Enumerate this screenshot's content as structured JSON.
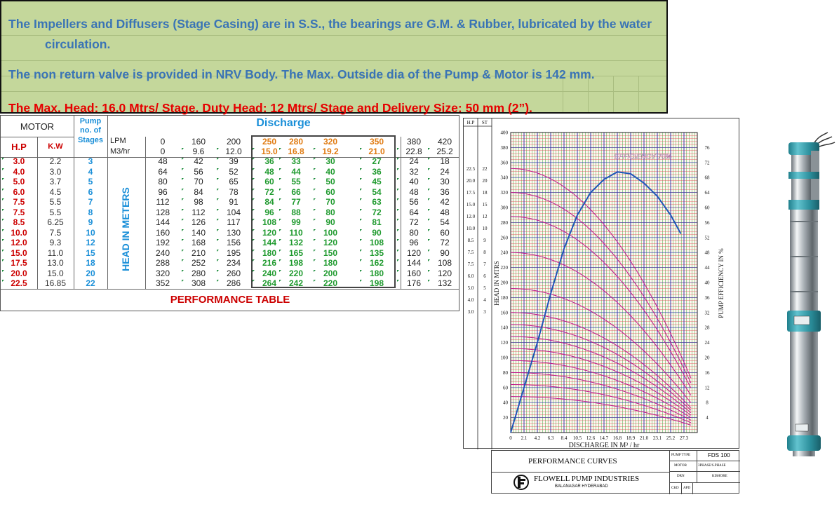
{
  "description": {
    "line1a": "The Impellers and Diffusers (Stage Casing) are in S.S., the bearings are G.M. & Rubber, lubricated by the water",
    "line1b": "circulation.",
    "line2": "The non return valve is provided in NRV Body.  The Max.  Outside dia of the Pump & Motor is 142 mm.",
    "line3": "The Max. Head: 16.0 Mtrs/ Stage. Duty Head: 12 Mtrs/ Stage and Delivery Size: 50 mm (2”)."
  },
  "table": {
    "motor_header": "MOTOR",
    "pump_header_1": "Pump",
    "pump_header_2": "no. of",
    "pump_header_3": "Stages",
    "hp_header": "H.P",
    "kw_header": "K.W",
    "discharge_header": "Discharge",
    "lpm_label": "LPM",
    "m3_label": "M3/hr",
    "head_label": "HEAD IN METERS",
    "footer": "PERFORMANCE TABLE",
    "lpm": [
      "0",
      "160",
      "200",
      "250",
      "280",
      "320",
      "350",
      "380",
      "420"
    ],
    "m3hr": [
      "0",
      "9.6",
      "12.0",
      "15.0",
      "16.8",
      "19.2",
      "21.0",
      "22.8",
      "25.2"
    ],
    "rows": [
      {
        "hp": "3.0",
        "kw": "2.2",
        "stages": "3",
        "heads": [
          "48",
          "42",
          "39",
          "36",
          "33",
          "30",
          "27",
          "24",
          "18"
        ]
      },
      {
        "hp": "4.0",
        "kw": "3.0",
        "stages": "4",
        "heads": [
          "64",
          "56",
          "52",
          "48",
          "44",
          "40",
          "36",
          "32",
          "24"
        ]
      },
      {
        "hp": "5.0",
        "kw": "3.7",
        "stages": "5",
        "heads": [
          "80",
          "70",
          "65",
          "60",
          "55",
          "50",
          "45",
          "40",
          "30"
        ]
      },
      {
        "hp": "6.0",
        "kw": "4.5",
        "stages": "6",
        "heads": [
          "96",
          "84",
          "78",
          "72",
          "66",
          "60",
          "54",
          "48",
          "36"
        ]
      },
      {
        "hp": "7.5",
        "kw": "5.5",
        "stages": "7",
        "heads": [
          "112",
          "98",
          "91",
          "84",
          "77",
          "70",
          "63",
          "56",
          "42"
        ]
      },
      {
        "hp": "7.5",
        "kw": "5.5",
        "stages": "8",
        "heads": [
          "128",
          "112",
          "104",
          "96",
          "88",
          "80",
          "72",
          "64",
          "48"
        ]
      },
      {
        "hp": "8.5",
        "kw": "6.25",
        "stages": "9",
        "heads": [
          "144",
          "126",
          "117",
          "108",
          "99",
          "90",
          "81",
          "72",
          "54"
        ]
      },
      {
        "hp": "10.0",
        "kw": "7.5",
        "stages": "10",
        "heads": [
          "160",
          "140",
          "130",
          "120",
          "110",
          "100",
          "90",
          "80",
          "60"
        ]
      },
      {
        "hp": "12.0",
        "kw": "9.3",
        "stages": "12",
        "heads": [
          "192",
          "168",
          "156",
          "144",
          "132",
          "120",
          "108",
          "96",
          "72"
        ]
      },
      {
        "hp": "15.0",
        "kw": "11.0",
        "stages": "15",
        "heads": [
          "240",
          "210",
          "195",
          "180",
          "165",
          "150",
          "135",
          "120",
          "90"
        ]
      },
      {
        "hp": "17.5",
        "kw": "13.0",
        "stages": "18",
        "heads": [
          "288",
          "252",
          "234",
          "216",
          "198",
          "180",
          "162",
          "144",
          "108"
        ]
      },
      {
        "hp": "20.0",
        "kw": "15.0",
        "stages": "20",
        "heads": [
          "320",
          "280",
          "260",
          "240",
          "220",
          "200",
          "180",
          "160",
          "120"
        ]
      },
      {
        "hp": "22.5",
        "kw": "16.85",
        "stages": "22",
        "heads": [
          "352",
          "308",
          "286",
          "264",
          "242",
          "220",
          "198",
          "176",
          "132"
        ]
      }
    ]
  },
  "chart_data": {
    "type": "line",
    "xlabel": "DISCHARGE IN M³ / hr",
    "ylabel": "HEAD  IN  MTRS",
    "y2label": "PUMP EFFICIENCY IN %",
    "annotation": "EFFICIENCY 70%",
    "x_ticks": [
      "0",
      "2.1",
      "4.2",
      "6.3",
      "8.4",
      "10.5",
      "12.6",
      "14.7",
      "16.8",
      "18.9",
      "21.0",
      "23.1",
      "25.2",
      "27.3"
    ],
    "y_ticks": [
      "400",
      "380",
      "360",
      "340",
      "320",
      "300",
      "280",
      "260",
      "240",
      "220",
      "200",
      "180",
      "160",
      "140",
      "120",
      "100",
      "80",
      "60",
      "40",
      "20"
    ],
    "y2_ticks": [
      "76",
      "72",
      "68",
      "64",
      "60",
      "56",
      "52",
      "48",
      "44",
      "40",
      "36",
      "32",
      "28",
      "24",
      "20",
      "16",
      "12",
      "8",
      "4"
    ],
    "xlim": [
      0,
      29.4
    ],
    "ylim": [
      0,
      400
    ],
    "y2lim": [
      0,
      80
    ],
    "hp_header": "H.P",
    "st_header": "ST",
    "hp_st": [
      {
        "hp": "22.5",
        "st": "22",
        "head": 352
      },
      {
        "hp": "20.0",
        "st": "20",
        "head": 320
      },
      {
        "hp": "17.5",
        "st": "18",
        "head": 288
      },
      {
        "hp": "15.0",
        "st": "15",
        "head": 240
      },
      {
        "hp": "12.0",
        "st": "12",
        "head": 192
      },
      {
        "hp": "10.0",
        "st": "10",
        "head": 160
      },
      {
        "hp": "8.5",
        "st": "9",
        "head": 144
      },
      {
        "hp": "7.5",
        "st": "8",
        "head": 128
      },
      {
        "hp": "7.5",
        "st": "7",
        "head": 112
      },
      {
        "hp": "6.0",
        "st": "6",
        "head": 96
      },
      {
        "hp": "5.0",
        "st": "5",
        "head": 80
      },
      {
        "hp": "4.0",
        "st": "4",
        "head": 64
      },
      {
        "hp": "3.0",
        "st": "3",
        "head": 48
      }
    ],
    "series": [
      {
        "x": [
          0,
          9.6,
          12.0,
          15.0,
          16.8,
          19.2,
          21.0,
          22.8,
          25.2
        ],
        "values": [
          352,
          308,
          286,
          264,
          242,
          220,
          198,
          176,
          132
        ]
      },
      {
        "x": [
          0,
          9.6,
          12.0,
          15.0,
          16.8,
          19.2,
          21.0,
          22.8,
          25.2
        ],
        "values": [
          320,
          280,
          260,
          240,
          220,
          200,
          180,
          160,
          120
        ]
      },
      {
        "x": [
          0,
          9.6,
          12.0,
          15.0,
          16.8,
          19.2,
          21.0,
          22.8,
          25.2
        ],
        "values": [
          288,
          252,
          234,
          216,
          198,
          180,
          162,
          144,
          108
        ]
      },
      {
        "x": [
          0,
          9.6,
          12.0,
          15.0,
          16.8,
          19.2,
          21.0,
          22.8,
          25.2
        ],
        "values": [
          240,
          210,
          195,
          180,
          165,
          150,
          135,
          120,
          90
        ]
      },
      {
        "x": [
          0,
          9.6,
          12.0,
          15.0,
          16.8,
          19.2,
          21.0,
          22.8,
          25.2
        ],
        "values": [
          192,
          168,
          156,
          144,
          132,
          120,
          108,
          96,
          72
        ]
      },
      {
        "x": [
          0,
          9.6,
          12.0,
          15.0,
          16.8,
          19.2,
          21.0,
          22.8,
          25.2
        ],
        "values": [
          160,
          140,
          130,
          120,
          110,
          100,
          90,
          80,
          60
        ]
      },
      {
        "x": [
          0,
          9.6,
          12.0,
          15.0,
          16.8,
          19.2,
          21.0,
          22.8,
          25.2
        ],
        "values": [
          144,
          126,
          117,
          108,
          99,
          90,
          81,
          72,
          54
        ]
      },
      {
        "x": [
          0,
          9.6,
          12.0,
          15.0,
          16.8,
          19.2,
          21.0,
          22.8,
          25.2
        ],
        "values": [
          128,
          112,
          104,
          96,
          88,
          80,
          72,
          64,
          48
        ]
      },
      {
        "x": [
          0,
          9.6,
          12.0,
          15.0,
          16.8,
          19.2,
          21.0,
          22.8,
          25.2
        ],
        "values": [
          112,
          98,
          91,
          84,
          77,
          70,
          63,
          56,
          42
        ]
      },
      {
        "x": [
          0,
          9.6,
          12.0,
          15.0,
          16.8,
          19.2,
          21.0,
          22.8,
          25.2
        ],
        "values": [
          96,
          84,
          78,
          72,
          66,
          60,
          54,
          48,
          36
        ]
      },
      {
        "x": [
          0,
          9.6,
          12.0,
          15.0,
          16.8,
          19.2,
          21.0,
          22.8,
          25.2
        ],
        "values": [
          80,
          70,
          65,
          60,
          55,
          50,
          45,
          40,
          30
        ]
      },
      {
        "x": [
          0,
          9.6,
          12.0,
          15.0,
          16.8,
          19.2,
          21.0,
          22.8,
          25.2
        ],
        "values": [
          64,
          56,
          52,
          48,
          44,
          40,
          36,
          32,
          24
        ]
      },
      {
        "x": [
          0,
          9.6,
          12.0,
          15.0,
          16.8,
          19.2,
          21.0,
          22.8,
          25.2
        ],
        "values": [
          48,
          42,
          39,
          36,
          33,
          30,
          27,
          24,
          18
        ]
      }
    ],
    "efficiency": {
      "x": [
        0,
        2.1,
        4.2,
        6.3,
        8.4,
        10.5,
        12.6,
        14.7,
        16.8,
        18.9,
        21.0,
        23.1,
        25.2,
        26.8
      ],
      "values": [
        0,
        12,
        24,
        37,
        49,
        58,
        64,
        67.5,
        69.5,
        69,
        66.5,
        63,
        58,
        53
      ]
    },
    "grid": true,
    "colors": {
      "grid_green": "#2fae3c",
      "grid_red": "#e6404a",
      "grid_blue": "#2d3fa8",
      "curve_magenta": "#c0168a",
      "efficiency_blue": "#1f55b8"
    }
  },
  "title_block": {
    "title": "PERFORMANCE  CURVES",
    "company": "FLOWELL  PUMP  INDUSTRIES",
    "address": "BALANAGAR HYDERABAD",
    "pump_type_label": "PUMP TYPE",
    "pump_type_value": "FDS 100",
    "motor_label": "MOTOR",
    "motor_value": "3PHASE/S.PHASE",
    "drn_label": "DRN",
    "drn_value": "KISHORE",
    "ckd_label": "CKD",
    "apd_label": "APD"
  }
}
